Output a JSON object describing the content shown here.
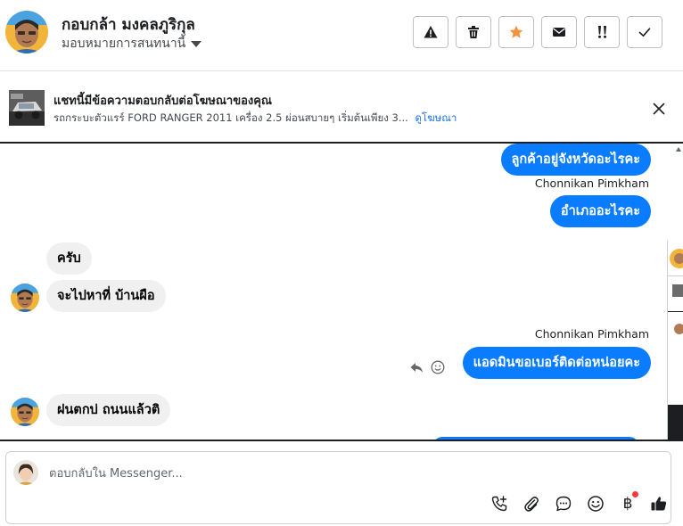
{
  "header": {
    "contact_name": "กอบกล้า มงคลภูริกุล",
    "assign_label": "มอบหมายการสนทนานี้",
    "buttons": [
      {
        "name": "spam-button",
        "icon": "warning-icon"
      },
      {
        "name": "delete-button",
        "icon": "trash-icon"
      },
      {
        "name": "star-button",
        "icon": "star-icon"
      },
      {
        "name": "mark-unread-button",
        "icon": "envelope-icon"
      },
      {
        "name": "follow-up-button",
        "icon": "exclamation-icon"
      },
      {
        "name": "mark-done-button",
        "icon": "check-icon"
      }
    ]
  },
  "banner": {
    "title": "แชทนี้มีข้อความตอบกลับต่อโฆษณาของคุณ",
    "subtitle": "รถกระบะตัวแรร์ FORD RANGER 2011 เครื่อง 2.5 ผ่อนสบายๆ เริ่มต้นเพียง 3...",
    "link": "ดูโฆษณา"
  },
  "messages": [
    {
      "direction": "out",
      "text": "ลูกค้าอยู่จังหวัดอะไรคะ"
    },
    {
      "sender": "Chonnikan Pimkham",
      "direction": "out",
      "text": "อำเภออะไรคะ"
    },
    {
      "direction": "in",
      "text": "ครับ"
    },
    {
      "direction": "in",
      "text": "จะไปหาที่ บ้านผือ"
    },
    {
      "sender": "Chonnikan Pimkham",
      "direction": "out",
      "text": "แอดมินขอเบอร์ติดต่อหน่อยคะ"
    },
    {
      "direction": "in",
      "text": "ฝนตกบ่ ถนนแล้วติ"
    }
  ],
  "composer": {
    "placeholder": "ตอบกลับใน Messenger...",
    "icons": [
      "add-call-icon",
      "attachment-icon",
      "saved-reply-icon",
      "emoji-icon",
      "payment-icon",
      "like-icon"
    ],
    "payment_symbol": "฿"
  },
  "colors": {
    "accent": "#0a7cff",
    "incoming_bubble": "#f0f0f0",
    "star": "#f5923e",
    "notification_dot": "#fa383e"
  }
}
